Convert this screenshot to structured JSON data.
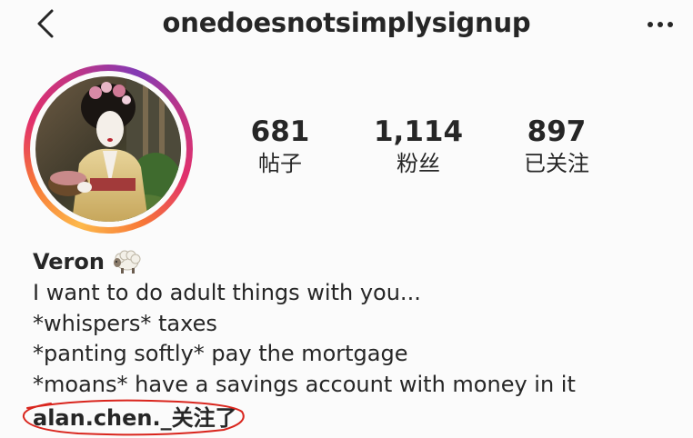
{
  "header": {
    "username": "onedoesnotsimplysignup"
  },
  "stats": {
    "posts": {
      "count": "681",
      "label": "帖子"
    },
    "followers": {
      "count": "1,114",
      "label": "粉丝"
    },
    "following": {
      "count": "897",
      "label": "已关注"
    }
  },
  "bio": {
    "name": "Veron",
    "emoji": "sheep-emoji",
    "lines": [
      "I want to do adult things with you...",
      "*whispers* taxes",
      "*panting softly* pay the mortgage",
      "*moans* have a savings account with money in it"
    ],
    "followed_by": "alan.chen._关注了"
  },
  "colors": {
    "text": "#262626",
    "annotation": "#d9251d",
    "ring_start": "#fdb94b",
    "ring_end": "#833ab4"
  },
  "icons": {
    "back": "chevron-left-icon",
    "more": "more-horizontal-icon"
  }
}
